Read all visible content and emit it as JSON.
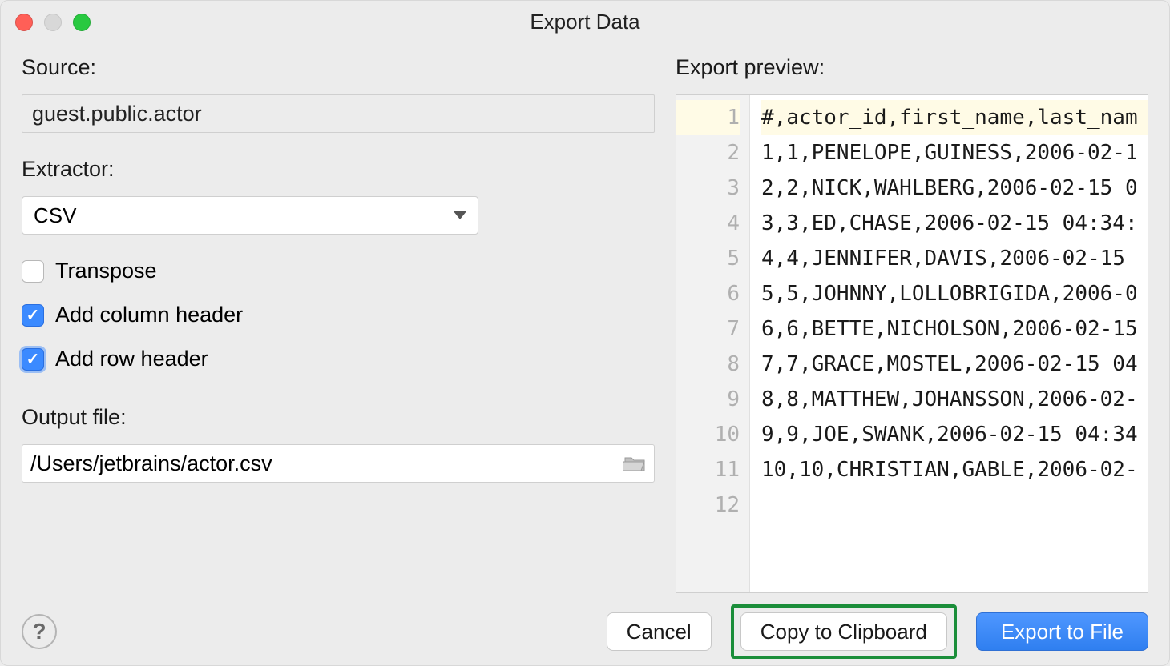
{
  "window": {
    "title": "Export Data"
  },
  "labels": {
    "source": "Source:",
    "extractor": "Extractor:",
    "output_file": "Output file:",
    "preview": "Export preview:"
  },
  "source": {
    "value": "guest.public.actor"
  },
  "extractor": {
    "value": "CSV"
  },
  "checkboxes": {
    "transpose": {
      "label": "Transpose",
      "checked": false
    },
    "add_col_header": {
      "label": "Add column header",
      "checked": true
    },
    "add_row_header": {
      "label": "Add row header",
      "checked": true,
      "focused": true
    }
  },
  "output": {
    "value": "/Users/jetbrains/actor.csv"
  },
  "preview_lines": [
    "#,actor_id,first_name,last_nam",
    "1,1,PENELOPE,GUINESS,2006-02-1",
    "2,2,NICK,WAHLBERG,2006-02-15 0",
    "3,3,ED,CHASE,2006-02-15 04:34:",
    "4,4,JENNIFER,DAVIS,2006-02-15 ",
    "5,5,JOHNNY,LOLLOBRIGIDA,2006-0",
    "6,6,BETTE,NICHOLSON,2006-02-15",
    "7,7,GRACE,MOSTEL,2006-02-15 04",
    "8,8,MATTHEW,JOHANSSON,2006-02-",
    "9,9,JOE,SWANK,2006-02-15 04:34",
    "10,10,CHRISTIAN,GABLE,2006-02-",
    ""
  ],
  "buttons": {
    "cancel": "Cancel",
    "copy": "Copy to Clipboard",
    "export": "Export to File",
    "help": "?"
  }
}
